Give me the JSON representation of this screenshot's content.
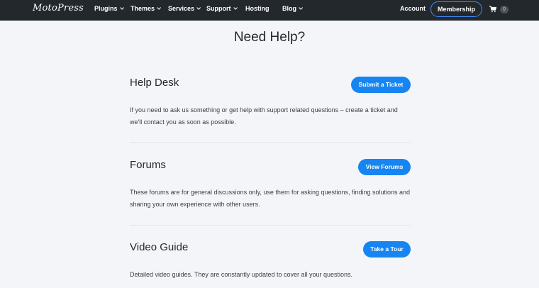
{
  "header": {
    "logo": "MotoPress",
    "nav": [
      "Plugins",
      "Themes",
      "Services",
      "Support",
      "Hosting",
      "Blog"
    ],
    "account": "Account",
    "membership": "Membership",
    "cart_count": "0"
  },
  "page": {
    "title": "Need Help?"
  },
  "sections": [
    {
      "title": "Help Desk",
      "button": "Submit a Ticket",
      "text": "If you need to ask us something or get help with support related questions – create a ticket and we'll contact you as soon as possible."
    },
    {
      "title": "Forums",
      "button": "View Forums",
      "text": "These forums are for general discussions only, use them for asking questions, finding solutions and sharing your own experience with other users."
    },
    {
      "title": "Video Guide",
      "button": "Take a Tour",
      "text": "Detailed video guides. They are constantly updated to cover all your questions."
    }
  ],
  "colors": {
    "header_bg": "#23282d",
    "accent": "#1685f2",
    "page_bg": "#f4f5f9"
  }
}
